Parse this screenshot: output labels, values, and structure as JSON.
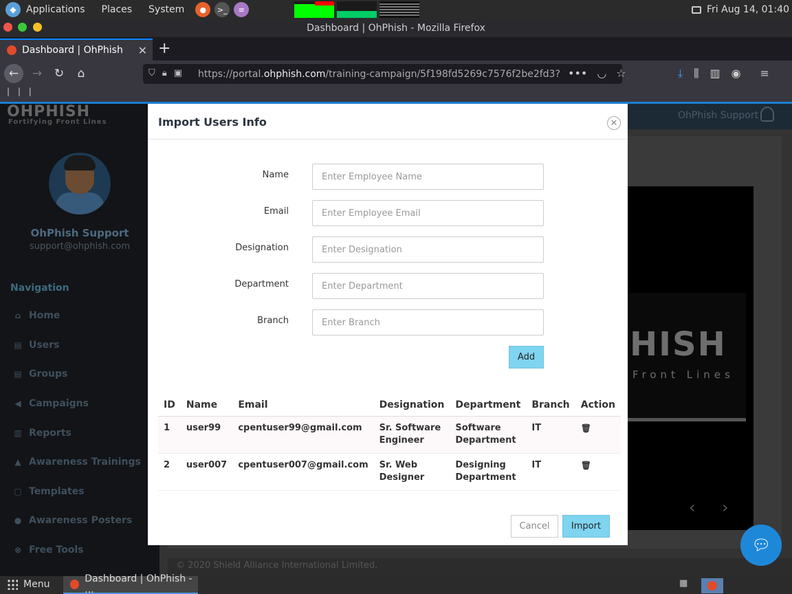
{
  "top_panel": {
    "menus": [
      "Applications",
      "Places",
      "System"
    ],
    "clock": "Fri Aug 14, 01:40"
  },
  "browser": {
    "window_title": "Dashboard | OhPhish - Mozilla Firefox",
    "tab_title": "Dashboard | OhPhish",
    "url_prefix": "https://portal.",
    "url_domain": "ohphish.com",
    "url_path": "/training-campaign/5f198fd5269c7576f2be2fd3?",
    "bookmarks_text": "| | |"
  },
  "sidebar": {
    "logo": "OHPHISH",
    "tagline": "Fortifying Front Lines",
    "user_name": "OhPhish Support",
    "user_email": "support@ohphish.com",
    "nav_title": "Navigation",
    "items": [
      {
        "label": "Home",
        "icon": "home-icon"
      },
      {
        "label": "Users",
        "icon": "users-icon"
      },
      {
        "label": "Groups",
        "icon": "groups-icon"
      },
      {
        "label": "Campaigns",
        "icon": "megaphone-icon"
      },
      {
        "label": "Reports",
        "icon": "bar-chart-icon"
      },
      {
        "label": "Awareness Trainings",
        "icon": "graduation-cap-icon"
      },
      {
        "label": "Templates",
        "icon": "template-icon"
      },
      {
        "label": "Awareness Posters",
        "icon": "globe-icon"
      },
      {
        "label": "Free Tools",
        "icon": "tools-icon"
      }
    ]
  },
  "header": {
    "user": "OhPhish Support"
  },
  "background_video": {
    "logo_text": "HISH",
    "logo_sub": "Front Lines"
  },
  "footer": {
    "text": "© 2020 Shield Alliance International Limited."
  },
  "modal": {
    "title": "Import Users Info",
    "fields": [
      {
        "label": "Name",
        "placeholder": "Enter Employee Name"
      },
      {
        "label": "Email",
        "placeholder": "Enter Employee Email"
      },
      {
        "label": "Designation",
        "placeholder": "Enter Designation"
      },
      {
        "label": "Department",
        "placeholder": "Enter Department"
      },
      {
        "label": "Branch",
        "placeholder": "Enter Branch"
      }
    ],
    "add_label": "Add",
    "table": {
      "columns": [
        "ID",
        "Name",
        "Email",
        "Designation",
        "Department",
        "Branch",
        "Action"
      ],
      "rows": [
        {
          "id": "1",
          "name": "user99",
          "email": "cpentuser99@gmail.com",
          "designation": "Sr. Software Engineer",
          "department": "Software Department",
          "branch": "IT"
        },
        {
          "id": "2",
          "name": "user007",
          "email": "cpentuser007@gmail.com",
          "designation": "Sr. Web Designer",
          "department": "Designing Department",
          "branch": "IT"
        }
      ]
    },
    "cancel_label": "Cancel",
    "import_label": "Import"
  },
  "taskbar": {
    "menu_label": "Menu",
    "window_label": "Dashboard | OhPhish - ..."
  }
}
